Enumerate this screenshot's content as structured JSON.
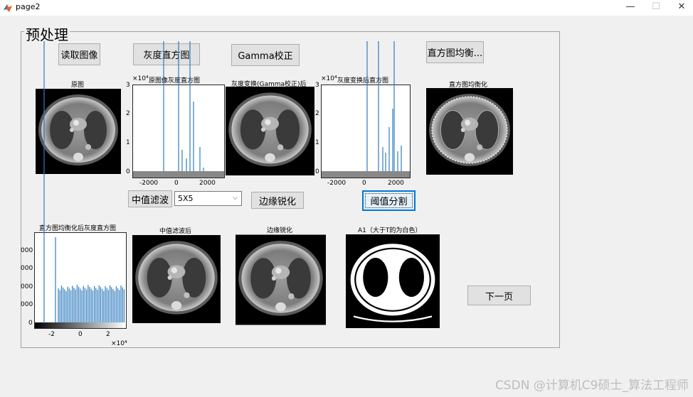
{
  "window": {
    "title": "page2",
    "min": "—",
    "max": "☐",
    "close": "✕"
  },
  "panel": {
    "title": "预处理"
  },
  "buttons": {
    "read_image": "读取图像",
    "gray_hist": "灰度直方图",
    "gamma": "Gamma校正",
    "hist_eq": "直方图均衡...",
    "median": "中值滤波",
    "edge": "边缘锐化",
    "threshold": "阈值分割",
    "next": "下一页"
  },
  "filter_select": {
    "value": "5X5"
  },
  "plots": {
    "original": {
      "title": "原图"
    },
    "hist_orig": {
      "title": "原图像灰度直方图",
      "exp": "×10⁴",
      "yticks": [
        "3",
        "2",
        "1",
        "0"
      ],
      "xticks": [
        "-2000",
        "0",
        "2000"
      ]
    },
    "gamma_img": {
      "title": "灰度变换(Gamma校正)后"
    },
    "hist_gamma": {
      "title": "灰度变换后直方图",
      "exp": "×10⁴",
      "yticks": [
        "3",
        "2",
        "1",
        "0"
      ],
      "xticks": [
        "-2000",
        "0",
        "2000"
      ]
    },
    "eq_img": {
      "title": "直方图均衡化"
    },
    "hist_eq": {
      "title": "直方图均衡化后灰度直方图",
      "yticks": [
        "000",
        "000",
        "000",
        "000",
        "0"
      ],
      "xticks": [
        "-2",
        "0",
        "2"
      ],
      "xexp": "×10⁴"
    },
    "median_img": {
      "title": "中值滤波后"
    },
    "edge_img": {
      "title": "边缘锐化"
    },
    "binary_img": {
      "title": "A1（大于T的为白色）"
    }
  },
  "watermark": "CSDN @计算机C9硕士_算法工程师"
}
